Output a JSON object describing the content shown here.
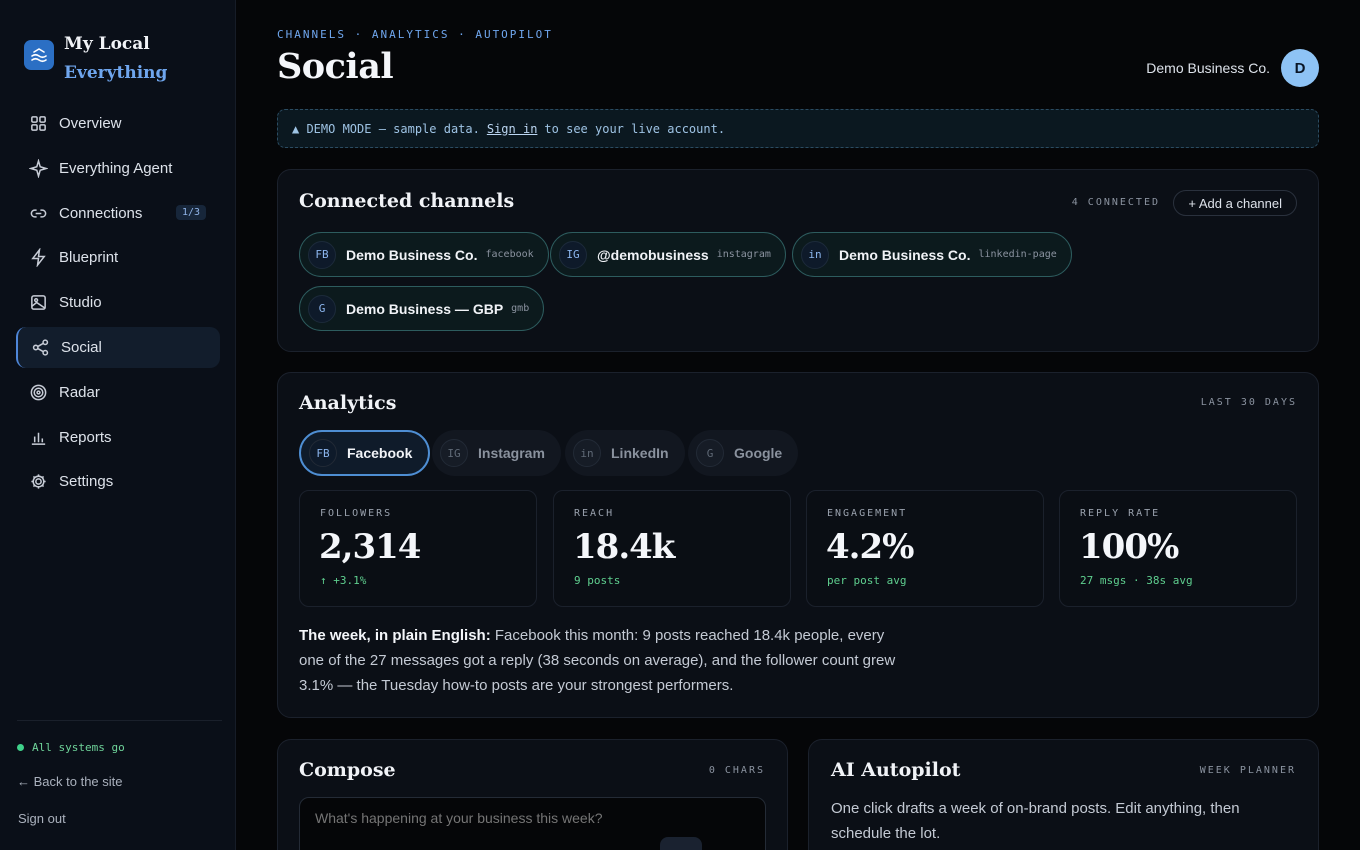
{
  "brand": {
    "line1": "My Local",
    "line2": "Everything"
  },
  "nav": {
    "items": [
      {
        "label": "Overview",
        "icon": "grid-icon"
      },
      {
        "label": "Everything Agent",
        "icon": "sparkle-icon"
      },
      {
        "label": "Connections",
        "icon": "link-icon",
        "badge": "1/3"
      },
      {
        "label": "Blueprint",
        "icon": "bolt-icon"
      },
      {
        "label": "Studio",
        "icon": "image-icon"
      },
      {
        "label": "Social",
        "icon": "share-icon",
        "active": true
      },
      {
        "label": "Radar",
        "icon": "radar-icon"
      },
      {
        "label": "Reports",
        "icon": "bar-chart-icon"
      },
      {
        "label": "Settings",
        "icon": "gear-icon"
      }
    ]
  },
  "sidebar_footer": {
    "status": "All systems go",
    "back": "← Back to the site",
    "signout": "Sign out"
  },
  "header": {
    "eyebrow": "CHANNELS · ANALYTICS · AUTOPILOT",
    "title": "Social",
    "account_name": "Demo Business Co.",
    "avatar_initial": "D"
  },
  "demo_banner": {
    "prefix": "▲ DEMO MODE — sample data.",
    "link": "Sign in",
    "suffix": "to see your live account."
  },
  "channels": {
    "title": "Connected channels",
    "count_label": "4 CONNECTED",
    "add_label": "+ Add a channel",
    "items": [
      {
        "abbr": "FB",
        "name": "Demo Business Co.",
        "type": "facebook"
      },
      {
        "abbr": "IG",
        "name": "@demobusiness",
        "type": "instagram"
      },
      {
        "abbr": "in",
        "name": "Demo Business Co.",
        "type": "linkedin-page"
      },
      {
        "abbr": "G",
        "name": "Demo Business — GBP",
        "type": "gmb"
      }
    ]
  },
  "analytics": {
    "title": "Analytics",
    "range": "LAST 30 DAYS",
    "tabs": [
      {
        "abbr": "FB",
        "label": "Facebook",
        "active": true
      },
      {
        "abbr": "IG",
        "label": "Instagram"
      },
      {
        "abbr": "in",
        "label": "LinkedIn"
      },
      {
        "abbr": "G",
        "label": "Google"
      }
    ],
    "stats": [
      {
        "label": "FOLLOWERS",
        "value": "2,314",
        "sub": "↑ +3.1%"
      },
      {
        "label": "REACH",
        "value": "18.4k",
        "sub": "9 posts"
      },
      {
        "label": "ENGAGEMENT",
        "value": "4.2%",
        "sub": "per post avg"
      },
      {
        "label": "REPLY RATE",
        "value": "100%",
        "sub": "27 msgs · 38s avg"
      }
    ],
    "summary_lead": "The week, in plain English:",
    "summary_body": "Facebook this month: 9 posts reached 18.4k people, every one of the 27 messages got a reply (38 seconds on average), and the follower count grew 3.1% — the Tuesday how-to posts are your strongest performers."
  },
  "compose": {
    "title": "Compose",
    "chars": "0 CHARS",
    "placeholder": "What's happening at your business this week?"
  },
  "autopilot": {
    "title": "AI Autopilot",
    "meta": "WEEK PLANNER",
    "text": "One click drafts a week of on-brand posts. Edit anything, then schedule the lot."
  },
  "colors": {
    "accent": "#6fa6ee",
    "active_border": "#4e8ed3",
    "success": "#3fd18a",
    "chip_border": "#2d5c5e"
  }
}
